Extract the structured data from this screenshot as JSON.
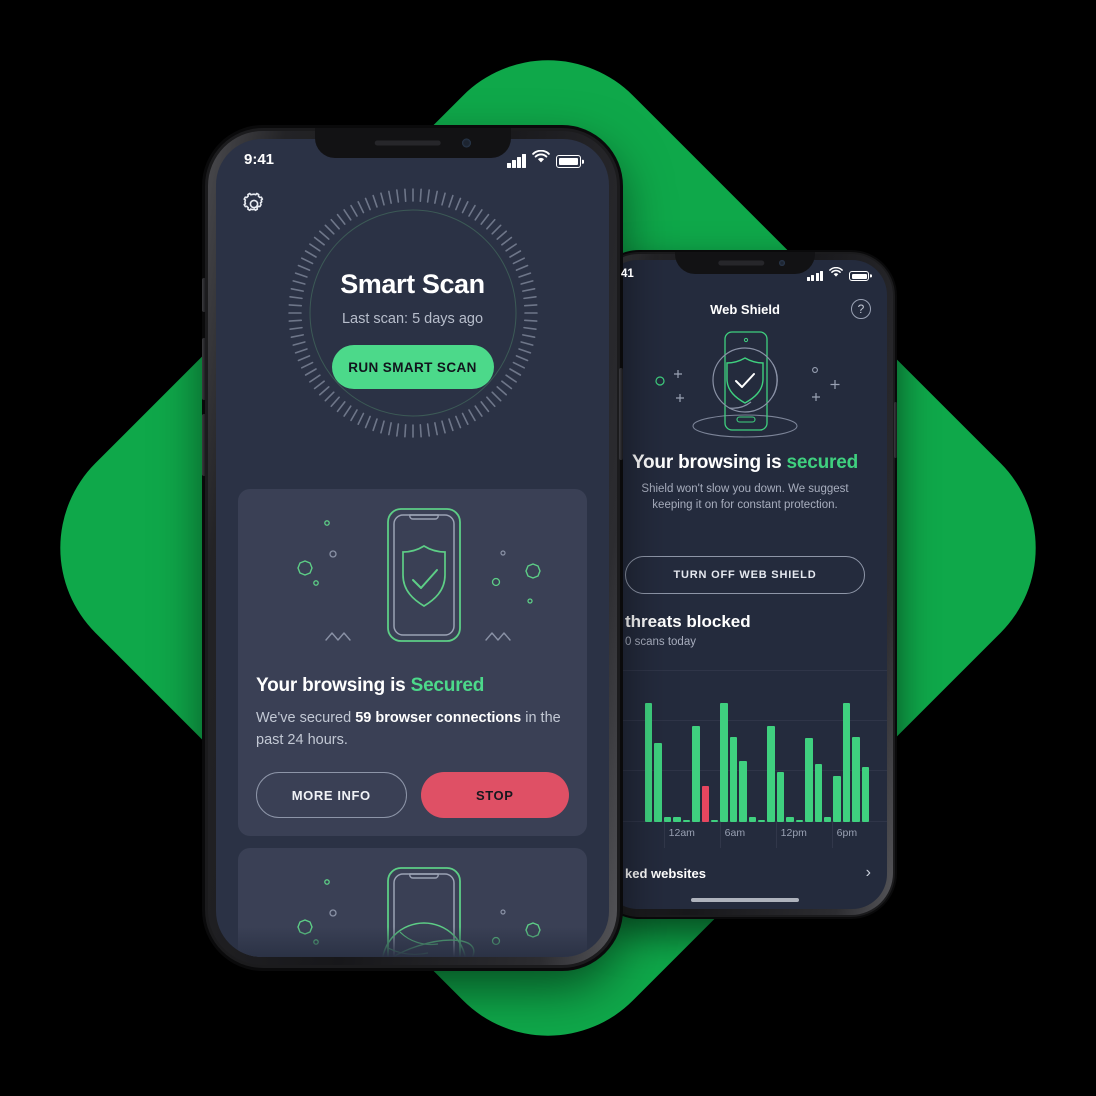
{
  "theme": {
    "brand_green": "#0FA84A",
    "accent_green": "#4CD98A",
    "chart_green": "#3FD07F",
    "alert_red": "#DF5065",
    "chart_red": "#E7465F",
    "screen_bg": "#2B3245",
    "card_bg": "#3A4055"
  },
  "front_phone": {
    "status_bar": {
      "time": "9:41",
      "signal_icon": "cellular-bars-icon",
      "wifi_icon": "wifi-icon",
      "battery_icon": "battery-icon"
    },
    "settings_icon": "gear-icon",
    "scan": {
      "title": "Smart Scan",
      "subtitle": "Last scan: 5 days ago",
      "button_label": "RUN SMART SCAN",
      "dial_icon": "radial-tick-dial"
    },
    "web_card": {
      "illustration_icon": "phone-shield-check-illustration",
      "headline_prefix": "Your browsing is ",
      "headline_status": "Secured",
      "body_prefix": "We've secured ",
      "body_highlight": "59 browser connections",
      "body_suffix": " in the past 24 hours.",
      "more_info_label": "MORE INFO",
      "stop_label": "STOP"
    },
    "next_card": {
      "illustration_icon": "phone-globe-wifi-illustration"
    }
  },
  "back_phone": {
    "status_bar": {
      "time": "41",
      "signal_icon": "cellular-bars-icon",
      "wifi_icon": "wifi-icon",
      "battery_icon": "battery-icon"
    },
    "header": {
      "title": "Web Shield",
      "help_icon": "question-circle-icon",
      "help_label": "?"
    },
    "illustration_icon": "phone-shield-ring-illustration",
    "headline_prefix": "Your browsing is ",
    "headline_status": "secured",
    "subtitle": "Shield won't slow you down. We suggest keeping it on for constant protection.",
    "turn_off_label": "TURN OFF WEB SHIELD",
    "stats": {
      "threats": "threats blocked",
      "scans": "0 scans today"
    },
    "footer": {
      "label": "ked websites",
      "chevron_icon": "chevron-right-icon"
    }
  },
  "chart_data": {
    "type": "bar",
    "title": "threats blocked",
    "subtitle": "0 scans today",
    "xlabel": "",
    "ylabel": "",
    "ylim": [
      0,
      100
    ],
    "grid": true,
    "legend": false,
    "tick_labels": [
      "12am",
      "6am",
      "12pm",
      "6pm"
    ],
    "tick_positions": [
      2,
      8,
      14,
      20
    ],
    "bar_color": "#3FD07F",
    "alert_color": "#E7465F",
    "categories": [
      "0",
      "1",
      "2",
      "3",
      "4",
      "5",
      "6",
      "7",
      "8",
      "9",
      "10",
      "11",
      "12",
      "13",
      "14",
      "15",
      "16",
      "17",
      "18",
      "19",
      "20",
      "21",
      "22",
      "23"
    ],
    "values": [
      78,
      52,
      3,
      3,
      0,
      63,
      24,
      0,
      78,
      56,
      40,
      3,
      0,
      63,
      33,
      3,
      0,
      55,
      38,
      3,
      30,
      78,
      56,
      36
    ],
    "alert_index": 6
  }
}
